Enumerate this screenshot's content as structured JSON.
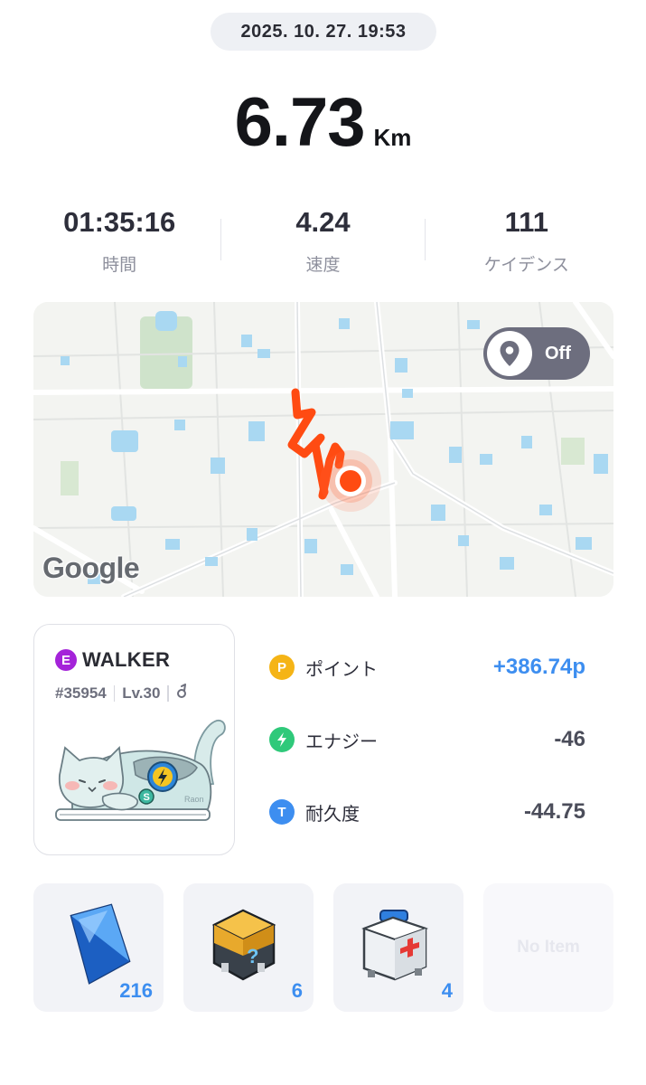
{
  "header": {
    "datetime": "2025. 10. 27. 19:53"
  },
  "distance": {
    "value": "6.73",
    "unit": "Km"
  },
  "stats": [
    {
      "value": "01:35:16",
      "label": "時間"
    },
    {
      "value": "4.24",
      "label": "速度"
    },
    {
      "value": "111",
      "label": "ケイデンス"
    }
  ],
  "map": {
    "location_toggle_state": "Off",
    "provider_logo": "Google",
    "route_color": "#ff4b12",
    "icons": [
      "location-pin-icon"
    ]
  },
  "shoe": {
    "grade": "E",
    "type": "WALKER",
    "id": "#35954",
    "level": "Lv.30",
    "badge_icon": "gender-icon",
    "grade_color": "#a423d9",
    "watermark": "Raon"
  },
  "rewards": [
    {
      "icon_letter": "P",
      "label": "ポイント",
      "value": "+386.74p",
      "icon_color": "#f5b416",
      "icon": "point-icon"
    },
    {
      "icon_letter": "⚡",
      "label": "エナジー",
      "value": "-46",
      "icon_color": "#2fc97a",
      "icon": "energy-icon"
    },
    {
      "icon_letter": "T",
      "label": "耐久度",
      "value": "-44.75",
      "icon_color": "#3d8ef0",
      "icon": "durability-icon"
    }
  ],
  "items": [
    {
      "name": "blue-crystal-icon",
      "count": "216"
    },
    {
      "name": "mystery-box-icon",
      "count": "6"
    },
    {
      "name": "first-aid-kit-icon",
      "count": "4"
    },
    {
      "name": "empty-slot",
      "label": "No Item"
    }
  ],
  "colors": {
    "accent_blue": "#3d8ef0",
    "text_dark": "#1f2026",
    "muted": "#8d8f9c"
  }
}
